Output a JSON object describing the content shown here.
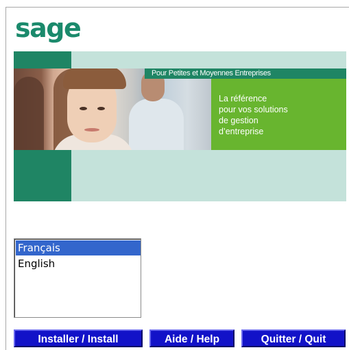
{
  "logo": {
    "text": "sage"
  },
  "banner": {
    "tagline": "Pour Petites et Moyennes Entreprises",
    "lines": [
      "La référence",
      "pour vos solutions",
      "de gestion",
      "d’entreprise"
    ]
  },
  "languages": {
    "items": [
      {
        "label": "Français",
        "selected": true
      },
      {
        "label": "English",
        "selected": false
      }
    ]
  },
  "buttons": {
    "install": "Installer / Install",
    "help": "Aide / Help",
    "quit": "Quitter / Quit"
  },
  "colors": {
    "brand_green": "#1b8a6c",
    "banner_dark_green": "#1f8564",
    "banner_light": "#c4e2da",
    "banner_lime": "#68b52f",
    "button_blue": "#1212c8",
    "selection_blue": "#3366cc"
  }
}
